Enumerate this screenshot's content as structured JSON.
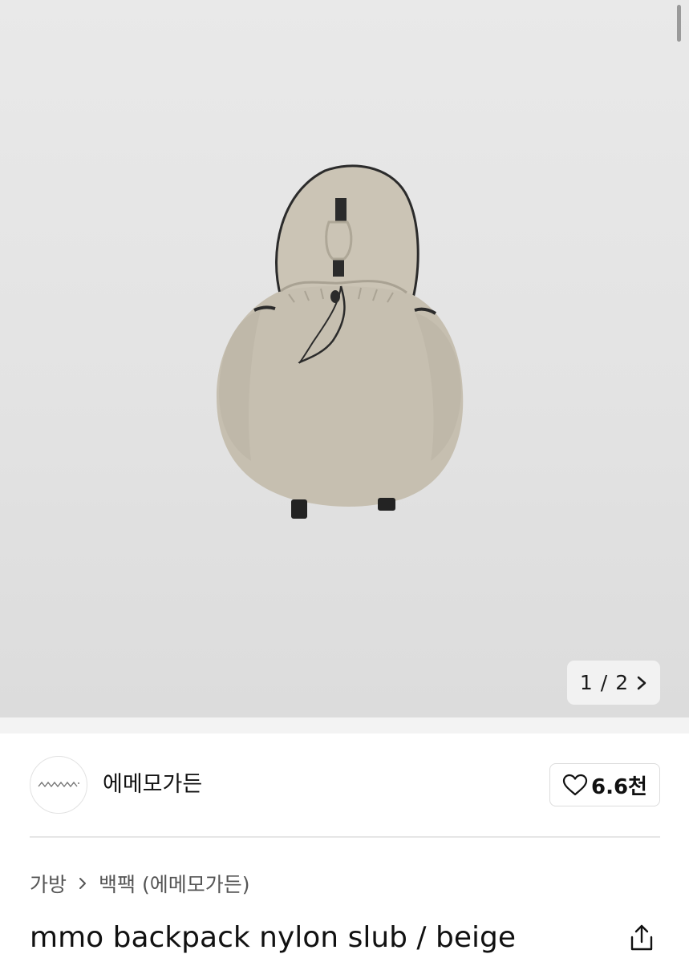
{
  "gallery": {
    "current": "1",
    "total": "2",
    "separator": "/",
    "next_icon": "chevron-right-icon"
  },
  "shop": {
    "name": "에메모가든",
    "avatar_icon": "wave-logo-icon",
    "like_icon": "heart-outline-icon",
    "like_count": "6.6천"
  },
  "breadcrumb": {
    "items": [
      "가방",
      "백팩 (에메모가든)"
    ],
    "separator_icon": "chevron-right-icon"
  },
  "product": {
    "title": "mmo backpack nylon slub / beige",
    "share_icon": "share-icon"
  },
  "colors": {
    "hero_bg": "#e3e3e3",
    "bag_fabric": "#c9c2b3",
    "bag_trim": "#2a2a2a"
  }
}
